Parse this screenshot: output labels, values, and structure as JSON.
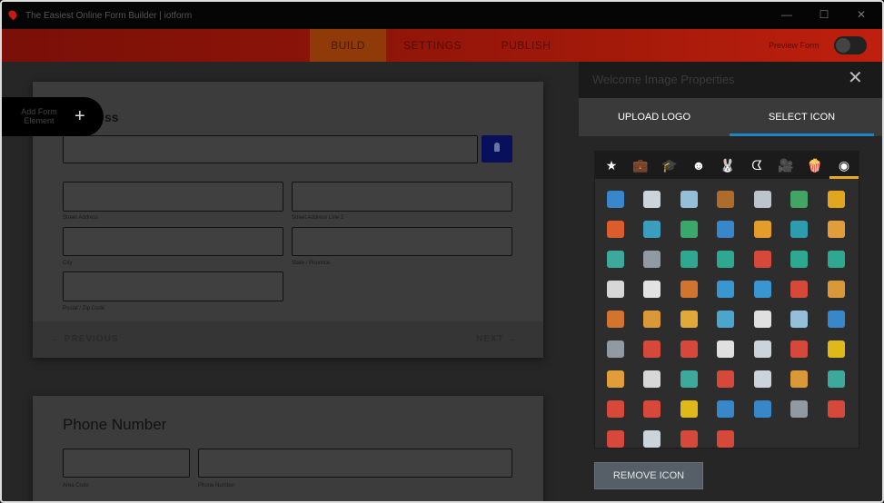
{
  "window": {
    "title": "The Easiest Online Form Builder | iotform",
    "min": "—",
    "max": "☐",
    "close": "✕"
  },
  "nav": {
    "tabs": [
      "BUILD",
      "SETTINGS",
      "PUBLISH"
    ],
    "preview_label": "Preview Form"
  },
  "builder": {
    "add_element_label": "Add Form Element",
    "add_element_plus": "+",
    "address_heading_peek": "ss",
    "address_labels": {
      "street": "Street Address",
      "street2": "Street Address Line 2",
      "city": "City",
      "state": "State / Province",
      "zip": "Postal / Zip Code"
    },
    "prev_label": "← PREVIOUS",
    "next_label": "NEXT →",
    "phone_heading": "Phone Number",
    "phone_labels": {
      "area": "Area Code",
      "number": "Phone Number"
    }
  },
  "panel": {
    "title": "Welcome Image Properties",
    "close": "✕",
    "tabs": [
      "UPLOAD LOGO",
      "SELECT ICON"
    ],
    "active_tab": "SELECT ICON",
    "categories": [
      {
        "name": "star-icon",
        "glyph": "★"
      },
      {
        "name": "briefcase-icon",
        "glyph": "💼"
      },
      {
        "name": "graduation-cap-icon",
        "glyph": "🎓"
      },
      {
        "name": "smiley-icon",
        "glyph": "☻"
      },
      {
        "name": "animal-icon",
        "glyph": "🐰"
      },
      {
        "name": "pacman-icon",
        "glyph": "ᗧ"
      },
      {
        "name": "camera-icon",
        "glyph": "🎥"
      },
      {
        "name": "popcorn-icon",
        "glyph": "🍿"
      },
      {
        "name": "flat-icons-icon",
        "glyph": "◉"
      }
    ],
    "active_category": "flat-icons-icon",
    "icons": [
      {
        "name": "id-card-icon",
        "glyph": "🪪",
        "color": "#3b8fd9"
      },
      {
        "name": "bank-icon",
        "glyph": "🏛",
        "color": "#d9e2ea"
      },
      {
        "name": "presentation-icon",
        "glyph": "📊",
        "color": "#9ecbe8"
      },
      {
        "name": "briefcase-icon",
        "glyph": "💼",
        "color": "#b8712c"
      },
      {
        "name": "chess-icon",
        "glyph": "♞",
        "color": "#c9d3dc"
      },
      {
        "name": "growth-chart-icon",
        "glyph": "📶",
        "color": "#44b06b"
      },
      {
        "name": "pie-chart-icon",
        "glyph": "◕",
        "color": "#f2b01e"
      },
      {
        "name": "donut-chart-icon",
        "glyph": "◔",
        "color": "#e9622b"
      },
      {
        "name": "laptop-icon",
        "glyph": "💻",
        "color": "#3da8c9"
      },
      {
        "name": "money-icon",
        "glyph": "💵",
        "color": "#3cb371"
      },
      {
        "name": "tag-icon",
        "glyph": "🏷",
        "color": "#3b8fd9"
      },
      {
        "name": "map-pin-icon",
        "glyph": "📍",
        "color": "#f4a72a"
      },
      {
        "name": "map-icon",
        "glyph": "🗺",
        "color": "#2fa6b8"
      },
      {
        "name": "email-icon",
        "glyph": "✉",
        "color": "#f0a73b"
      },
      {
        "name": "safe-icon",
        "glyph": "▣",
        "color": "#3fb4a6"
      },
      {
        "name": "router-icon",
        "glyph": "▬",
        "color": "#9aa4ad"
      },
      {
        "name": "cloud-check-icon",
        "glyph": "☁",
        "color": "#2fb39a"
      },
      {
        "name": "cloud-download-icon",
        "glyph": "☁",
        "color": "#2fb39a"
      },
      {
        "name": "cloud-error-icon",
        "glyph": "☁",
        "color": "#e44b3c"
      },
      {
        "name": "cloud-sync-icon",
        "glyph": "☁",
        "color": "#2fb39a"
      },
      {
        "name": "cloud-upload-icon",
        "glyph": "☁",
        "color": "#2fb39a"
      },
      {
        "name": "document-edit-icon",
        "glyph": "📝",
        "color": "#e6e6e6"
      },
      {
        "name": "notepad-icon",
        "glyph": "📄",
        "color": "#f2f2f2"
      },
      {
        "name": "donut-icon",
        "glyph": "🍩",
        "color": "#e07b2e"
      },
      {
        "name": "water-drop-icon",
        "glyph": "💧",
        "color": "#3b9fe0"
      },
      {
        "name": "eye-icon",
        "glyph": "👁",
        "color": "#3b9fe0"
      },
      {
        "name": "foam-finger-icon",
        "glyph": "☝",
        "color": "#e44b3c"
      },
      {
        "name": "burger-icon",
        "glyph": "🍔",
        "color": "#e9a33a"
      },
      {
        "name": "hotdog-icon",
        "glyph": "🌭",
        "color": "#e07b2e"
      },
      {
        "name": "muffin-icon",
        "glyph": "🧁",
        "color": "#e9a33a"
      },
      {
        "name": "pizza-icon",
        "glyph": "🍕",
        "color": "#f0b43a"
      },
      {
        "name": "knot-icon",
        "glyph": "∞",
        "color": "#4fb0d8"
      },
      {
        "name": "yin-yang-icon",
        "glyph": "☯",
        "color": "#f0f0f0"
      },
      {
        "name": "easel-chart-icon",
        "glyph": "📈",
        "color": "#9ecbe8"
      },
      {
        "name": "flag-icon",
        "glyph": "⚑",
        "color": "#3b8fd9"
      },
      {
        "name": "monitor-icon",
        "glyph": "🖥",
        "color": "#9aa4ad"
      },
      {
        "name": "target-icon",
        "glyph": "🎯",
        "color": "#e44b3c"
      },
      {
        "name": "push-pin-icon",
        "glyph": "📌",
        "color": "#e44b3c"
      },
      {
        "name": "clock-icon",
        "glyph": "◷",
        "color": "#f0f0f0"
      },
      {
        "name": "calculator-icon",
        "glyph": "🧮",
        "color": "#d9e2ea"
      },
      {
        "name": "alarm-clock-icon",
        "glyph": "⏰",
        "color": "#e44b3c"
      },
      {
        "name": "light-bulb-icon",
        "glyph": "💡",
        "color": "#f0c419"
      },
      {
        "name": "stopwatch-icon",
        "glyph": "⏱",
        "color": "#f0a73b"
      },
      {
        "name": "pillar-icon",
        "glyph": "Ⅰ",
        "color": "#e6e6e6"
      },
      {
        "name": "backpack-icon",
        "glyph": "🎒",
        "color": "#3fb4a6"
      },
      {
        "name": "suitcase-icon",
        "glyph": "🧳",
        "color": "#e44b3c"
      },
      {
        "name": "barcode-icon",
        "glyph": "▥",
        "color": "#d9e2ea"
      },
      {
        "name": "basket-icon",
        "glyph": "🧺",
        "color": "#e9a33a"
      },
      {
        "name": "teacher-icon",
        "glyph": "👨‍🏫",
        "color": "#3fb4a6"
      },
      {
        "name": "swiss-knife-icon",
        "glyph": "🔪",
        "color": "#e44b3c"
      },
      {
        "name": "first-aid-icon",
        "glyph": "✚",
        "color": "#e44b3c"
      },
      {
        "name": "price-tag-icon",
        "glyph": "🏷",
        "color": "#f0c419"
      },
      {
        "name": "store-icon",
        "glyph": "🏪",
        "color": "#3b8fd9"
      },
      {
        "name": "ink-bottle-icon",
        "glyph": "🧴",
        "color": "#3b8fd9"
      },
      {
        "name": "cassette-icon",
        "glyph": "📼",
        "color": "#9aa4ad"
      },
      {
        "name": "browser-window-icon",
        "glyph": "🗔",
        "color": "#e44b3c"
      },
      {
        "name": "cash-register-icon",
        "glyph": "🧾",
        "color": "#e44b3c"
      },
      {
        "name": "rocket-icon",
        "glyph": "🚀",
        "color": "#d9e2ea"
      },
      {
        "name": "printer-icon",
        "glyph": "🖨",
        "color": "#e44b3c"
      },
      {
        "name": "truck-icon",
        "glyph": "🚚",
        "color": "#e44b3c"
      }
    ],
    "remove_label": "REMOVE ICON"
  }
}
